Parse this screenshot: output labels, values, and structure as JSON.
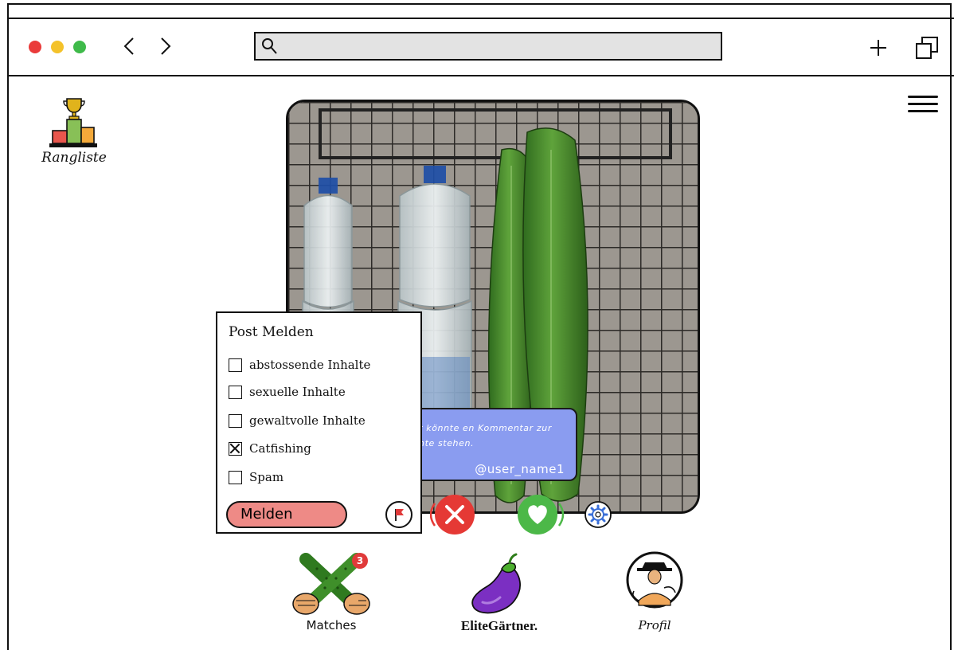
{
  "browser": {
    "search": {
      "value": "",
      "placeholder": ""
    }
  },
  "leaderboard": {
    "label": "Rangliste"
  },
  "post": {
    "comment": {
      "text": "Hier könnte ein Kommentar zur Aubergine stehen.",
      "visible_text": "r könnte en Kommentar zur nte stehen.",
      "user": "@user_name1"
    }
  },
  "report_dialog": {
    "title": "Post Melden",
    "options": [
      {
        "label": "abstossende Inhalte",
        "checked": false
      },
      {
        "label": "sexuelle Inhalte",
        "checked": false
      },
      {
        "label": "gewaltvolle Inhalte",
        "checked": false
      },
      {
        "label": "Catfishing",
        "checked": true
      },
      {
        "label": "Spam",
        "checked": false
      }
    ],
    "submit_label": "Melden"
  },
  "bottom_nav": {
    "matches": {
      "label": "Matches",
      "badge": "3"
    },
    "home": {
      "label": "EliteGärtner."
    },
    "profile": {
      "label": "Profil"
    }
  },
  "colors": {
    "reject": "#e53935",
    "like": "#4cb848",
    "comment_bg": "#8a9cf0",
    "report_button": "#ee8a86",
    "badge": "#e03a3a"
  }
}
